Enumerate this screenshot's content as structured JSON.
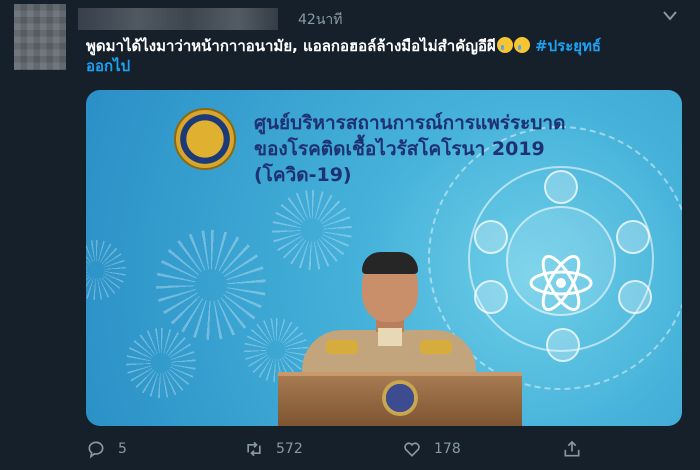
{
  "tweet": {
    "time": "42นาที",
    "text_main": "พูดมาได้ไงมาว่าหน้ากาาอนามัย, แอลกอฮอล์ล้างมือไม่สำคัญอีผี",
    "hashtag_part1": "#ประยุทธ์",
    "hashtag_part2": "ออกไป"
  },
  "media": {
    "title_line1": "ศูนย์บริหารสถานการณ์การแพร่ระบาด",
    "title_line2": "ของโรคติดเชื้อไวรัสโคโรนา 2019 (โควิด-19)"
  },
  "actions": {
    "reply_count": "5",
    "retweet_count": "572",
    "like_count": "178"
  },
  "icons": [
    "caret-down-icon",
    "reply-icon",
    "retweet-icon",
    "like-icon",
    "share-icon",
    "crying-face-emoji"
  ],
  "colors": {
    "background": "#15202b",
    "accent": "#1da1f2",
    "muted": "#8899a6"
  }
}
